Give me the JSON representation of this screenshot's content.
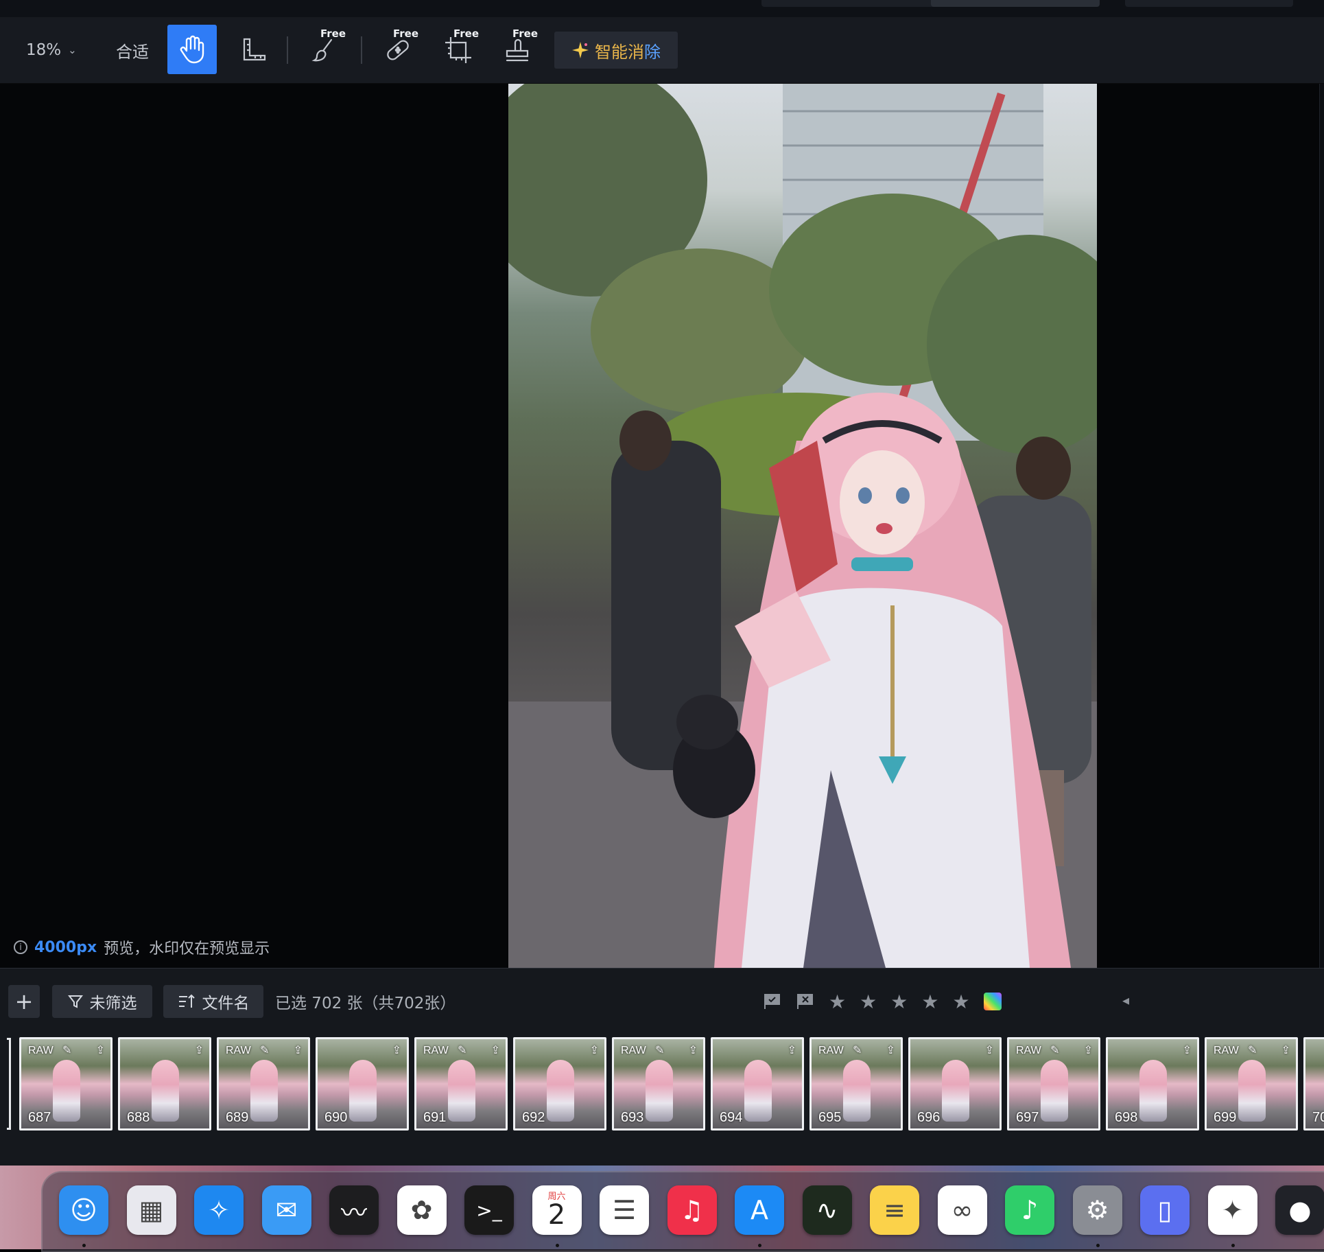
{
  "toolbar": {
    "zoom_value": "18%",
    "zoom_chevron": "⌄",
    "fit_label": "合适",
    "hand_icon": "hand-icon",
    "ruler_icon": "ruler-icon",
    "free_badge": "Free",
    "tools": [
      {
        "name": "portrait-brush-tool",
        "icon": "brush-icon"
      },
      {
        "name": "heal-tool",
        "icon": "bandage-icon"
      },
      {
        "name": "crop-tool",
        "icon": "crop-icon"
      },
      {
        "name": "stamp-tool",
        "icon": "stamp-icon"
      }
    ],
    "ai_erase_label_main": "智能消",
    "ai_erase_label_accent": "除",
    "ai_icon": "sparkle-icon"
  },
  "canvas": {
    "info_px": "4000px",
    "info_text": "预览，水印仅在预览显示"
  },
  "filmstrip": {
    "add_label": "+",
    "filter_label": "未筛选",
    "sort_label": "文件名",
    "selection_text": "已选 702 张（共702张）",
    "rating_icons": [
      "flag-icon",
      "reject-flag-icon",
      "star-icon",
      "star-icon",
      "star-icon",
      "star-icon",
      "star-icon",
      "color-label-icon"
    ],
    "thumbnails": [
      {
        "num": "687",
        "raw": "RAW"
      },
      {
        "num": "688",
        "raw": ""
      },
      {
        "num": "689",
        "raw": "RAW"
      },
      {
        "num": "690",
        "raw": ""
      },
      {
        "num": "691",
        "raw": "RAW"
      },
      {
        "num": "692",
        "raw": ""
      },
      {
        "num": "693",
        "raw": "RAW"
      },
      {
        "num": "694",
        "raw": ""
      },
      {
        "num": "695",
        "raw": "RAW"
      },
      {
        "num": "696",
        "raw": ""
      },
      {
        "num": "697",
        "raw": "RAW"
      },
      {
        "num": "698",
        "raw": ""
      },
      {
        "num": "699",
        "raw": "RAW"
      },
      {
        "num": "70",
        "raw": ""
      }
    ]
  },
  "dock": {
    "apps": [
      {
        "name": "Finder",
        "color": "#2e8ff0"
      },
      {
        "name": "Launchpad",
        "color": "#e8e8ee"
      },
      {
        "name": "Safari",
        "color": "#1e88f0"
      },
      {
        "name": "Mail",
        "color": "#3a9bf5"
      },
      {
        "name": "Voice Memos",
        "color": "#1d1d1f"
      },
      {
        "name": "Photos",
        "color": "#ffffff"
      },
      {
        "name": "Terminal",
        "color": "#1a1a1a"
      },
      {
        "name": "Calendar",
        "color": "#ffffff",
        "weekday": "周六",
        "day": "2"
      },
      {
        "name": "Reminders",
        "color": "#ffffff"
      },
      {
        "name": "Music",
        "color": "#f0304a"
      },
      {
        "name": "App Store",
        "color": "#1c8af5"
      },
      {
        "name": "Activity Monitor",
        "color": "#1e2a1e"
      },
      {
        "name": "Notes",
        "color": "#fbd24a"
      },
      {
        "name": "Baidu Netdisk",
        "color": "#ffffff"
      },
      {
        "name": "QQ Music",
        "color": "#2fce6a"
      },
      {
        "name": "System Settings",
        "color": "#8a8d94"
      },
      {
        "name": "Simulator",
        "color": "#5b6ff0"
      },
      {
        "name": "Pixelmator",
        "color": "#ffffff"
      },
      {
        "name": "DaVinci Resolve",
        "color": "#202228"
      }
    ]
  }
}
